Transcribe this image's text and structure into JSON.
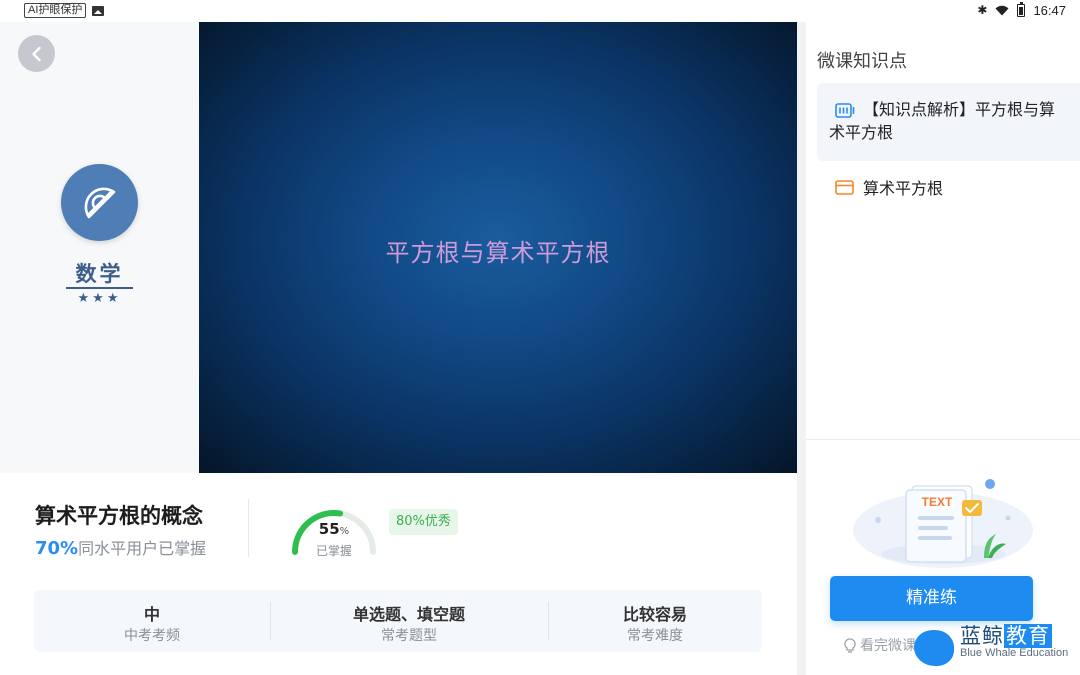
{
  "status_bar": {
    "ai_badge": "AI护眼保护",
    "time": "16:47",
    "icons": [
      "image-icon",
      "bluetooth-icon",
      "wifi-icon",
      "battery-icon"
    ]
  },
  "subject": {
    "name": "数学",
    "stars": "★★★",
    "logo_icon": "protractor-icon"
  },
  "video": {
    "title": "平方根与算术平方根"
  },
  "topic": {
    "title": "算术平方根的概念",
    "mastery_pct": "70%",
    "mastery_text": "同水平用户已掌握",
    "gauge_value": "55",
    "gauge_unit": "%",
    "gauge_fraction": 0.55,
    "gauge_label": "已掌握",
    "excellent_badge": "80%优秀"
  },
  "stats": [
    {
      "value": "中",
      "label": "中考考频"
    },
    {
      "value": "单选题、填空题",
      "label": "常考题型"
    },
    {
      "value": "比较容易",
      "label": "常考难度"
    }
  ],
  "right_panel": {
    "title": "微课知识点",
    "items": [
      {
        "label": "【知识点解析】平方根与算术平方根",
        "icon": "video-icon",
        "active": true
      },
      {
        "label": "算术平方根",
        "icon": "card-icon",
        "active": false
      }
    ],
    "illustration_text": "TEXT",
    "practice_button": "精准练",
    "hint": "看完微课"
  },
  "watermark": {
    "cn_prefix": "蓝鲸",
    "cn_box": "教育",
    "en": "Blue Whale Education"
  },
  "colors": {
    "accent": "#1e8bf1",
    "subject": "#4f7db5",
    "success": "#3fae52"
  }
}
